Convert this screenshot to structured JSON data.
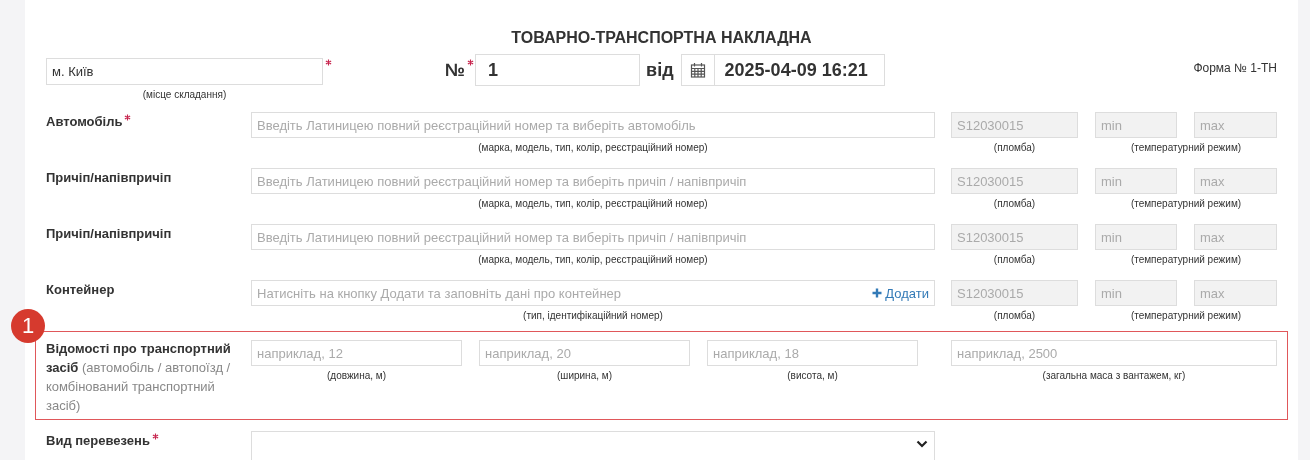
{
  "title": "ТОВАРНО-ТРАНСПОРТНА НАКЛАДНА",
  "header": {
    "place": {
      "value": "м. Київ",
      "required": true,
      "hint": "(місце складання)"
    },
    "number": {
      "label": "№",
      "required": true,
      "value": "1"
    },
    "date": {
      "label": "від",
      "value": "2025-04-09 16:21"
    },
    "form_label": "Форма № 1-ТН"
  },
  "vehicle_rows": [
    {
      "label": "Автомобіль",
      "required": true,
      "placeholder": "Введіть Латиницею повний реєстраційний номер та виберіть автомобіль",
      "hint": "(марка, модель, тип, колір, реєстраційний номер)",
      "seal": {
        "placeholder": "S12030015",
        "disabled": true,
        "hint": "(пломба)"
      },
      "temp_min": {
        "placeholder": "min",
        "disabled": true
      },
      "temp_max": {
        "placeholder": "max",
        "disabled": true
      },
      "temp_hint": "(температурний режим)"
    },
    {
      "label": "Причіп/напівпричіп",
      "required": false,
      "placeholder": "Введіть Латиницею повний реєстраційний номер та виберіть причіп / напівпричіп",
      "hint": "(марка, модель, тип, колір, реєстраційний номер)",
      "seal": {
        "placeholder": "S12030015",
        "disabled": true,
        "hint": "(пломба)"
      },
      "temp_min": {
        "placeholder": "min",
        "disabled": true
      },
      "temp_max": {
        "placeholder": "max",
        "disabled": true
      },
      "temp_hint": "(температурний режим)"
    },
    {
      "label": "Причіп/напівпричіп",
      "required": false,
      "placeholder": "Введіть Латиницею повний реєстраційний номер та виберіть причіп / напівпричіп",
      "hint": "(марка, модель, тип, колір, реєстраційний номер)",
      "seal": {
        "placeholder": "S12030015",
        "disabled": true,
        "hint": "(пломба)"
      },
      "temp_min": {
        "placeholder": "min",
        "disabled": true
      },
      "temp_max": {
        "placeholder": "max",
        "disabled": true
      },
      "temp_hint": "(температурний режим)"
    },
    {
      "label": "Контейнер",
      "required": false,
      "placeholder": "Натисніть на кнопку Додати та заповніть дані про контейнер",
      "add_button": "Додати",
      "hint": "(тип, ідентифікаційний номер)",
      "seal": {
        "placeholder": "S12030015",
        "disabled": true,
        "hint": "(пломба)"
      },
      "temp_min": {
        "placeholder": "min",
        "disabled": true
      },
      "temp_max": {
        "placeholder": "max",
        "disabled": true
      },
      "temp_hint": "(температурний режим)"
    }
  ],
  "vehicle_info": {
    "badge": "1",
    "highlighted": true,
    "label": "**Відомості про транспортний засіб** (автомобіль / автопоїзд / комбінований транспортний засіб)",
    "fields": [
      {
        "placeholder": "наприклад, 12",
        "hint": "(довжина, м)"
      },
      {
        "placeholder": "наприклад, 20",
        "hint": "(ширина, м)"
      },
      {
        "placeholder": "наприклад, 18",
        "hint": "(висота, м)"
      },
      {
        "placeholder": "наприклад, 2500",
        "hint": "(загальна маса з вантажем, кг)"
      }
    ]
  },
  "transport_type": {
    "label": "Вид перевезень",
    "required": true
  }
}
